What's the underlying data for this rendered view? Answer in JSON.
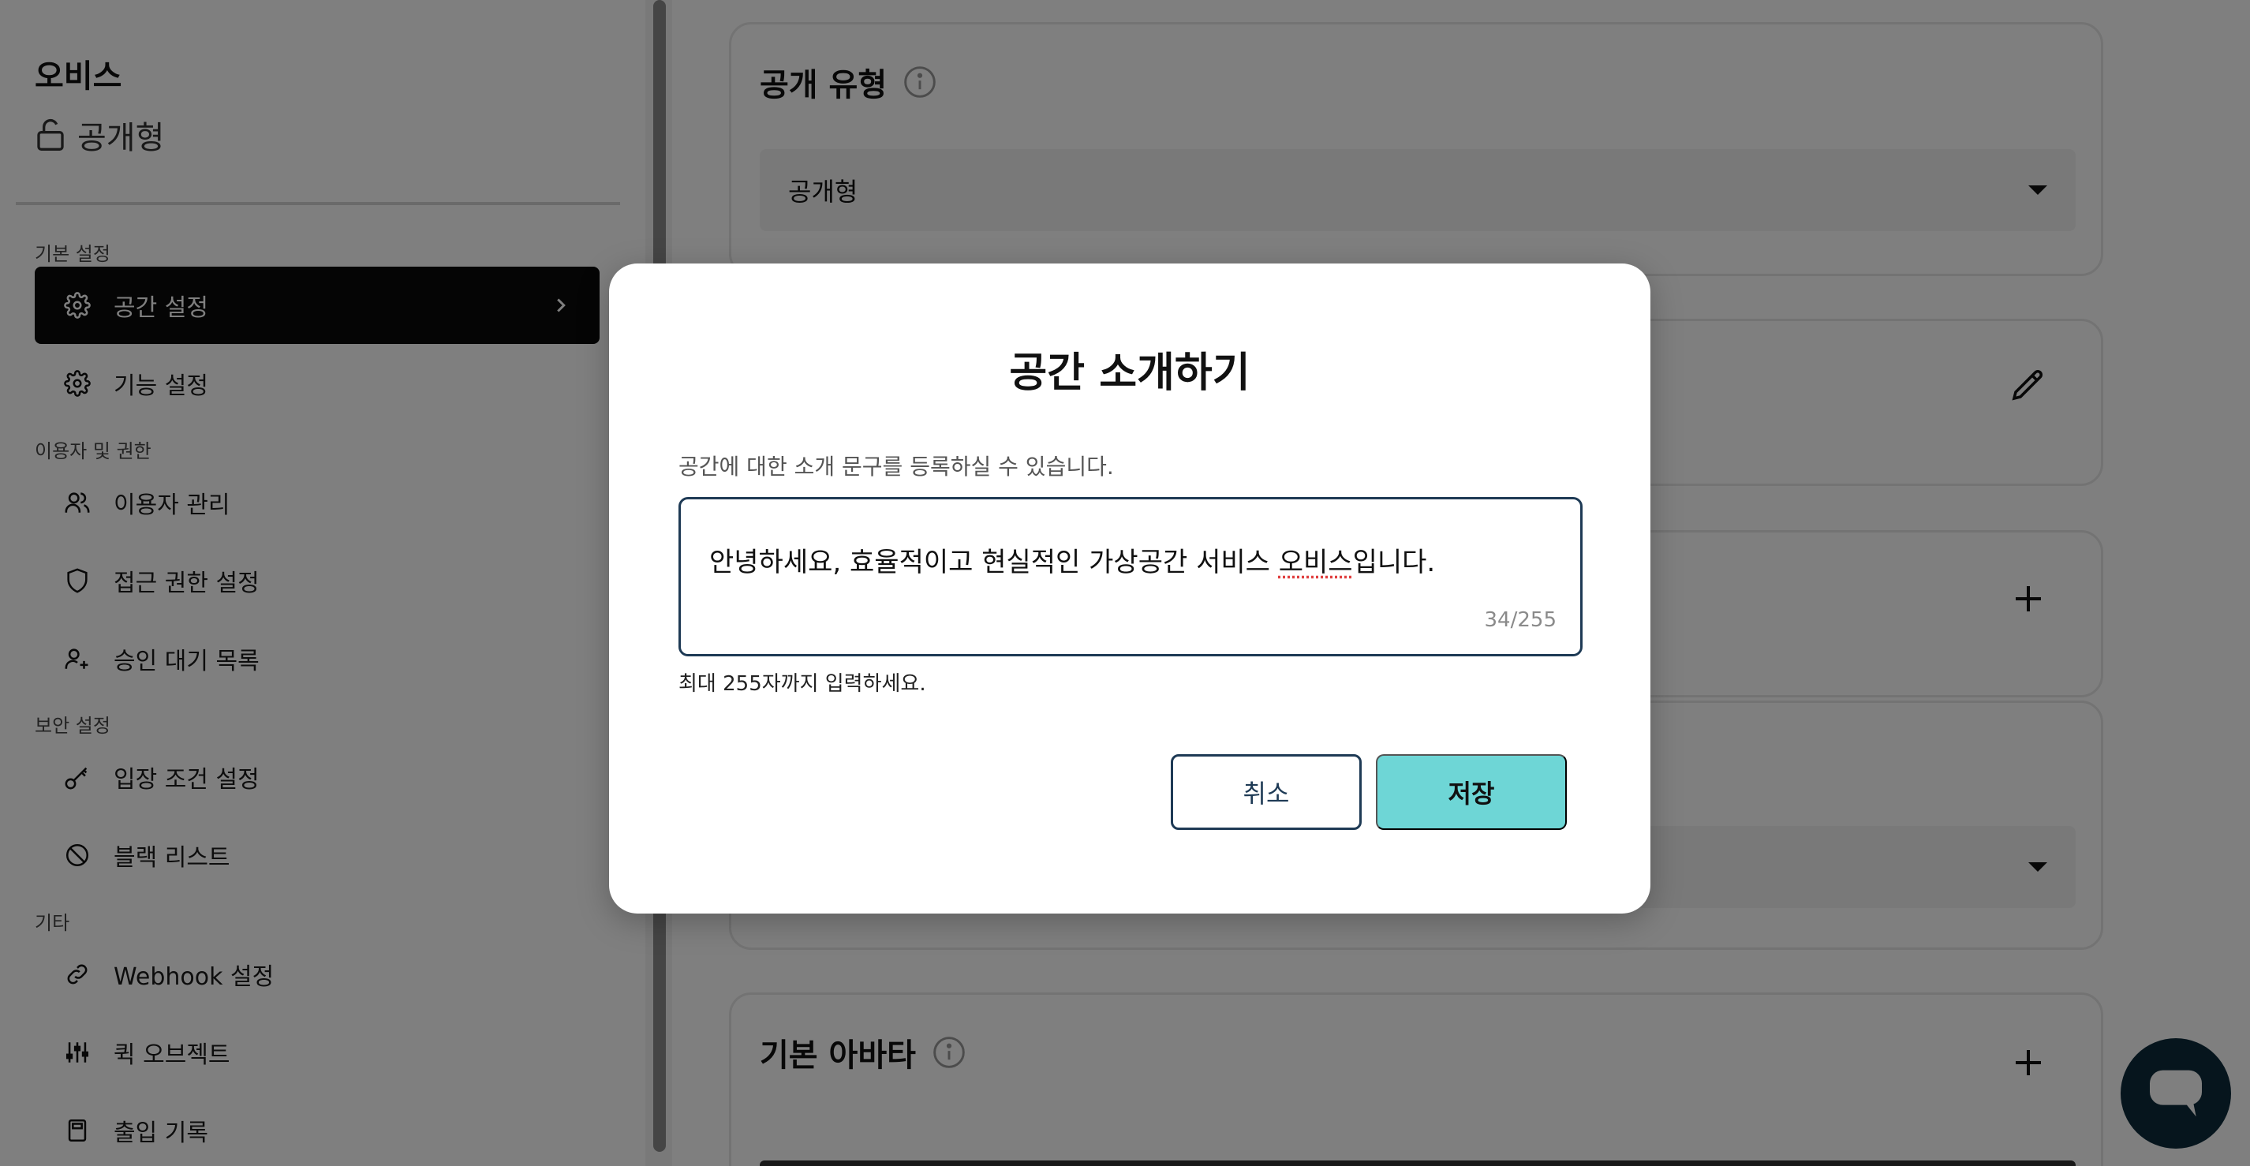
{
  "sidebar": {
    "space_name": "오비스",
    "space_type": "공개형",
    "sections": [
      {
        "label": "기본 설정"
      },
      {
        "label": "이용자 및 권한"
      },
      {
        "label": "보안 설정"
      },
      {
        "label": "기타"
      }
    ],
    "items": [
      {
        "label": "공간 설정",
        "icon": "gear-icon",
        "active": true
      },
      {
        "label": "기능 설정",
        "icon": "gear-icon"
      },
      {
        "label": "이용자 관리",
        "icon": "users-icon"
      },
      {
        "label": "접근 권한 설정",
        "icon": "shield-icon"
      },
      {
        "label": "승인 대기 목록",
        "icon": "user-plus-icon"
      },
      {
        "label": "입장 조건 설정",
        "icon": "key-icon"
      },
      {
        "label": "블랙 리스트",
        "icon": "block-icon"
      },
      {
        "label": "Webhook 설정",
        "icon": "link-icon"
      },
      {
        "label": "퀵 오브젝트",
        "icon": "sliders-icon"
      },
      {
        "label": "출입 기록",
        "icon": "log-icon"
      }
    ]
  },
  "main": {
    "visibility_card": {
      "title": "공개 유형",
      "selected": "공개형"
    },
    "avatar_card": {
      "title": "기본 아바타"
    }
  },
  "modal": {
    "title": "공간 소개하기",
    "description": "공간에 대한 소개 문구를 등록하실 수 있습니다.",
    "text_before": "안녕하세요, 효율적이고 현실적인 가상공간 서비스 ",
    "text_flagged": "오비스",
    "text_after": "입니다.",
    "char_count": "34/255",
    "helper": "최대 255자까지 입력하세요.",
    "cancel_label": "취소",
    "save_label": "저장"
  },
  "colors": {
    "accent": "#6ed6d6",
    "border_focus": "#1e3a55",
    "sidebar_active": "#0b0b0b",
    "chat_button": "#0d2a3a"
  }
}
